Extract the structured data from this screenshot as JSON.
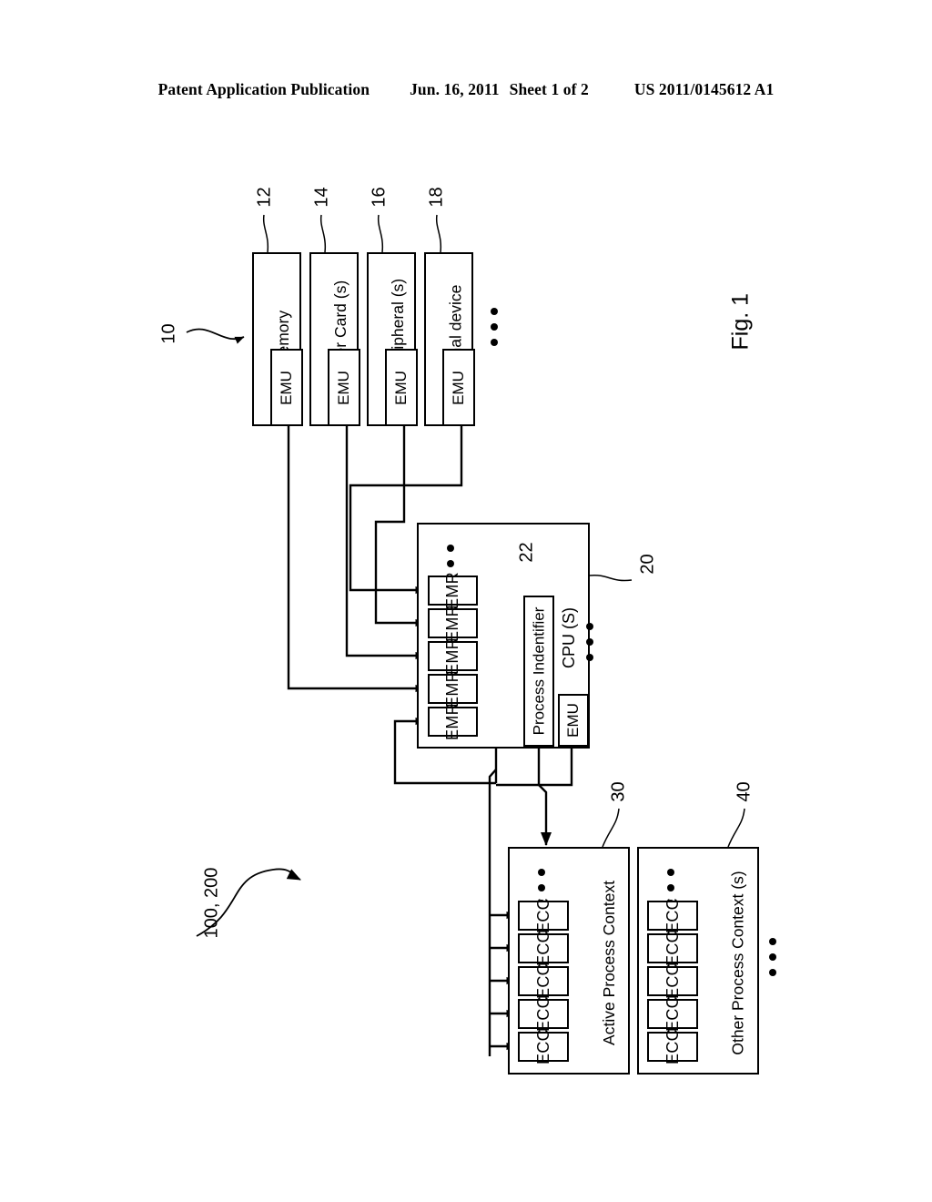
{
  "header": {
    "publication": "Patent Application Publication",
    "date": "Jun. 16, 2011",
    "sheet": "Sheet 1 of 2",
    "patent_number": "US 2011/0145612 A1"
  },
  "figure": {
    "label": "Fig. 1",
    "system_ref": "100, 200",
    "group_ref": "10"
  },
  "devices": [
    {
      "name": "Memory",
      "ref": "12",
      "sub": "EMU"
    },
    {
      "name": "Adapter Card (s)",
      "ref": "14",
      "sub": "EMU"
    },
    {
      "name": "I/O Peripheral (s)",
      "ref": "16",
      "sub": "EMU"
    },
    {
      "name": "External device",
      "ref": "18",
      "sub": "EMU"
    }
  ],
  "cpu": {
    "ref": "20",
    "title": "CPU (S)",
    "emu": "EMU",
    "process_identifier": {
      "label": "Process Indentifier",
      "ref": "22"
    },
    "registers": [
      {
        "label": "EMR"
      },
      {
        "label": "EMR"
      },
      {
        "label": "EMR"
      },
      {
        "label": "EMR"
      },
      {
        "label": "EMR"
      }
    ]
  },
  "contexts": [
    {
      "ref": "30",
      "title": "Active Process Context",
      "cells": [
        {
          "label": "ECC"
        },
        {
          "label": "ECC"
        },
        {
          "label": "ECC"
        },
        {
          "label": "ECC"
        },
        {
          "label": "ECC"
        }
      ]
    },
    {
      "ref": "40",
      "title": "Other Process Context (s)",
      "cells": [
        {
          "label": "ECC"
        },
        {
          "label": "ECC"
        },
        {
          "label": "ECC"
        },
        {
          "label": "ECC"
        },
        {
          "label": "ECC"
        }
      ]
    }
  ]
}
